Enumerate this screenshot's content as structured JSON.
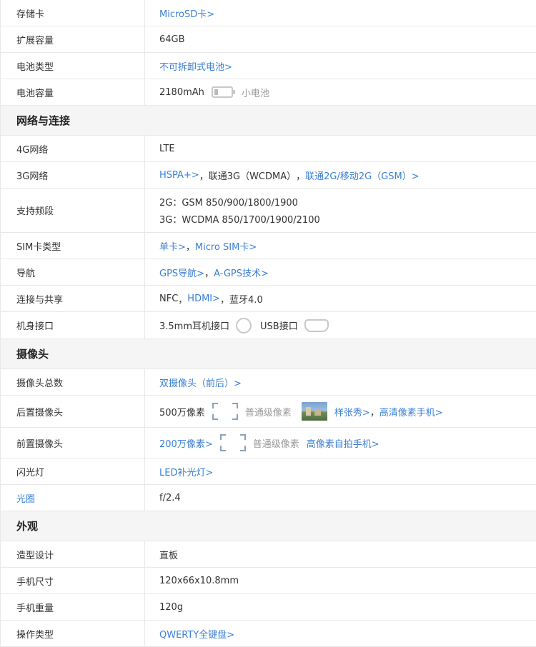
{
  "rows_top": [
    {
      "label": "存储卡",
      "value": "MicroSD卡>"
    },
    {
      "label": "扩展容量",
      "value": "64GB"
    },
    {
      "label": "电池类型",
      "value": "不可拆卸式电池>"
    },
    {
      "label": "电池容量",
      "value": "2180mAh",
      "note": "小电池",
      "icon": "battery-icon"
    }
  ],
  "section_network": "网络与连接",
  "network": {
    "lte": {
      "label": "4G网络",
      "value": "LTE"
    },
    "g3": {
      "label": "3G网络",
      "link1": "HSPA+>",
      "sep1": "，",
      "text2": "联通3G（WCDMA）",
      "sep2": "，",
      "link3": "联通2G/移动2G（GSM）>"
    },
    "bands": {
      "label": "支持频段",
      "line1": "2G：GSM 850/900/1800/1900",
      "line2": "3G：WCDMA 850/1700/1900/2100"
    },
    "sim": {
      "label": "SIM卡类型",
      "link1": "单卡>",
      "sep": "，",
      "link2": "Micro SIM卡>"
    },
    "nav": {
      "label": "导航",
      "link1": "GPS导航>",
      "sep": "，",
      "link2": "A-GPS技术>"
    },
    "share": {
      "label": "连接与共享",
      "text1": "NFC",
      "sep1": "，",
      "link2": "HDMI>",
      "sep2": "，",
      "text3": "蓝牙4.0"
    },
    "ports": {
      "label": "机身接口",
      "text1": "3.5mm耳机接口",
      "icon1": "headphone-jack-icon",
      "text2": "USB接口",
      "icon2": "usb-port-icon"
    }
  },
  "section_camera": "摄像头",
  "camera": {
    "total": {
      "label": "摄像头总数",
      "value": "双摄像头（前后）>"
    },
    "rear": {
      "label": "后置摄像头",
      "text1": "500万像素",
      "note": "普通级像素",
      "link2": "样张秀>",
      "sep": "，",
      "link3": "高清像素手机>"
    },
    "front": {
      "label": "前置摄像头",
      "link1": "200万像素>",
      "note": "普通级像素",
      "link2": "高像素自拍手机>"
    },
    "flash": {
      "label": "闪光灯",
      "value": "LED补光灯>"
    },
    "aperture": {
      "label": "光圈",
      "value": "f/2.4"
    }
  },
  "section_look": "外观",
  "look": [
    {
      "label": "造型设计",
      "value": "直板",
      "link": false
    },
    {
      "label": "手机尺寸",
      "value": "120x66x10.8mm",
      "link": false
    },
    {
      "label": "手机重量",
      "value": "120g",
      "link": false
    },
    {
      "label": "操作类型",
      "value": "QWERTY全键盘>",
      "link": true
    }
  ],
  "colors": {
    "link": "#3a7fd5",
    "border": "#e8e8e8",
    "section_bg": "#f5f5f5"
  }
}
